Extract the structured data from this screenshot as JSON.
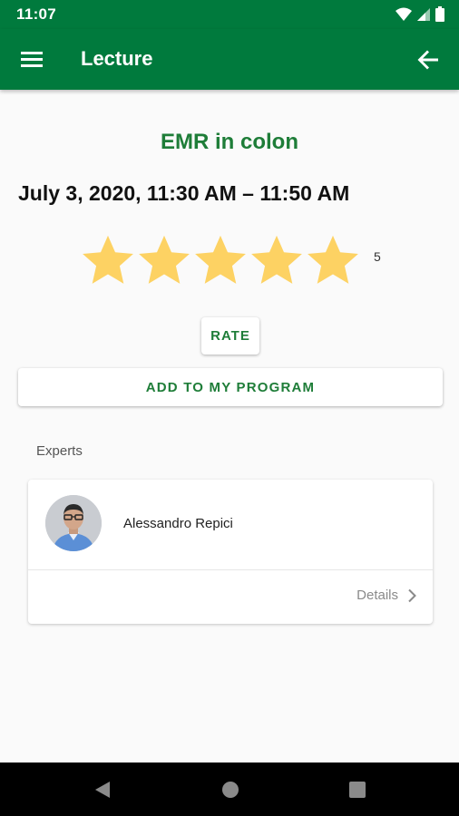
{
  "status_bar": {
    "time": "11:07"
  },
  "app_bar": {
    "title": "Lecture"
  },
  "lecture": {
    "title": "EMR in colon",
    "date_time": "July 3, 2020, 11:30 AM – 11:50 AM",
    "rating": {
      "stars_filled": 5,
      "stars_total": 5,
      "count_label": "5"
    }
  },
  "actions": {
    "rate_label": "RATE",
    "add_program_label": "ADD TO MY PROGRAM"
  },
  "experts": {
    "section_label": "Experts",
    "items": [
      {
        "name": "Alessandro Repici",
        "details_label": "Details"
      }
    ]
  },
  "colors": {
    "primary": "#007a3d",
    "accent_text": "#1e7d38",
    "star": "#fdd263"
  },
  "icons": {
    "status": [
      "wifi-icon",
      "signal-icon",
      "battery-icon"
    ],
    "app_bar": [
      "menu-icon",
      "arrow-back-icon"
    ],
    "nav": [
      "nav-back-icon",
      "nav-home-icon",
      "nav-recents-icon"
    ]
  }
}
